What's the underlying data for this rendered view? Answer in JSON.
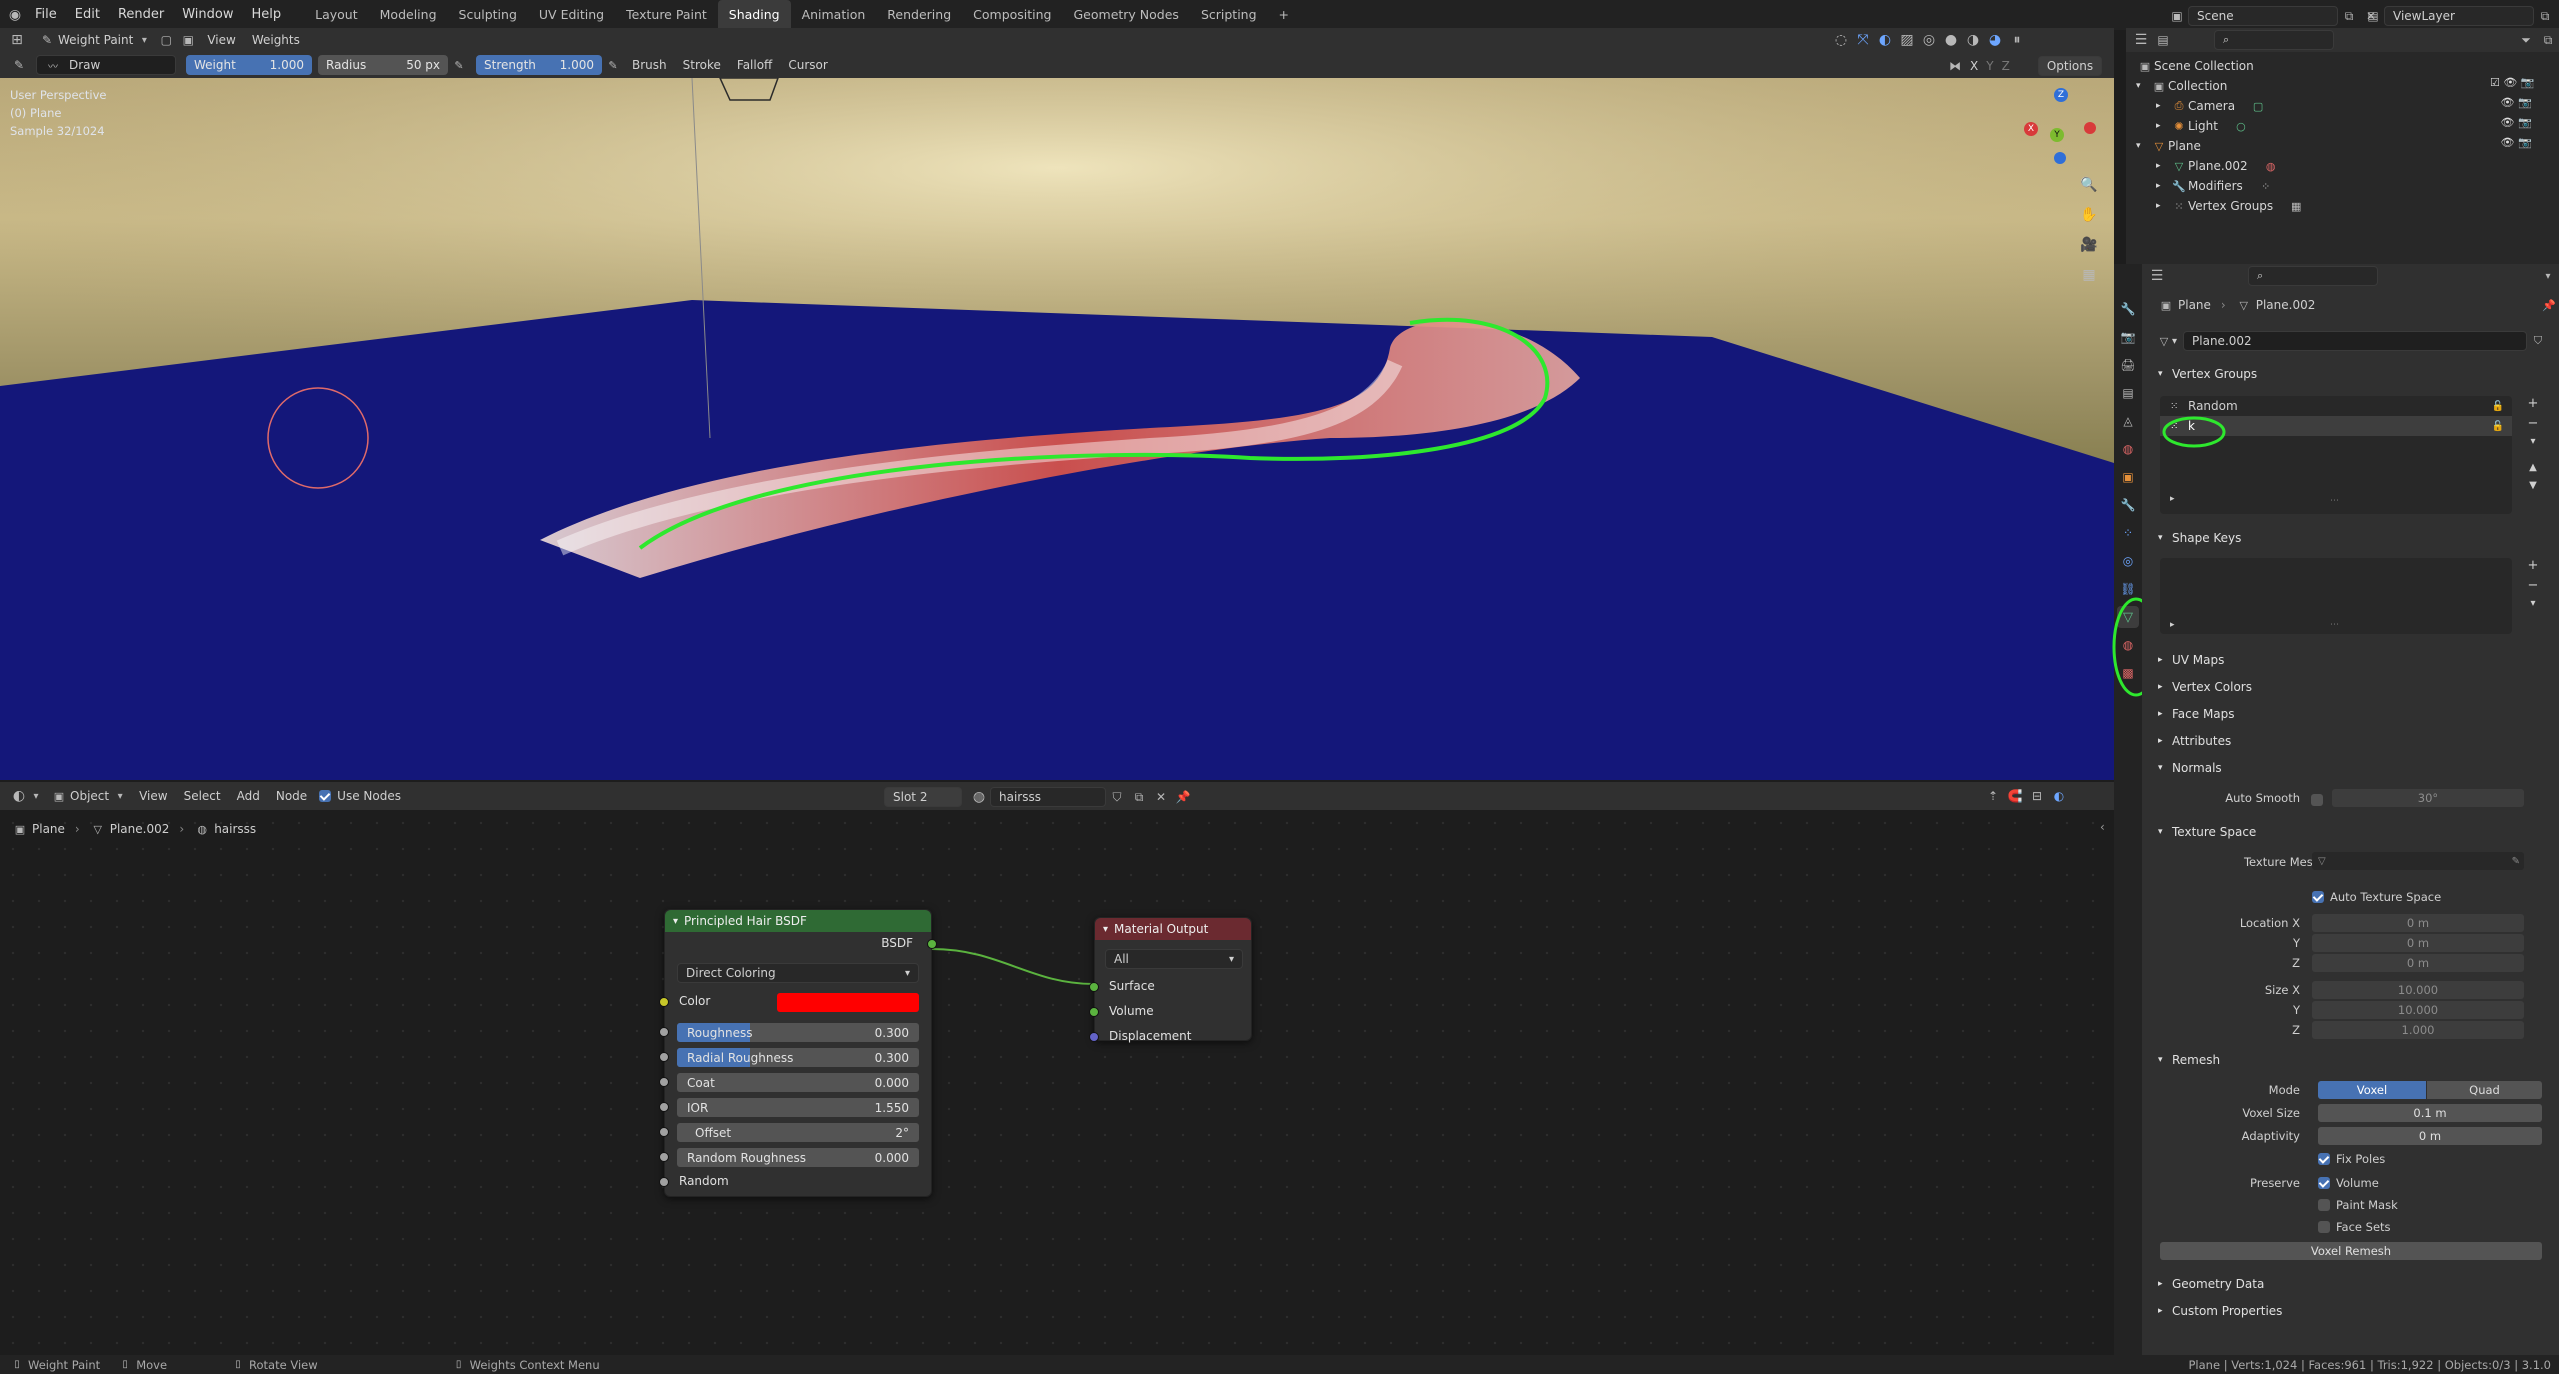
{
  "topbar": {
    "menu": [
      "File",
      "Edit",
      "Render",
      "Window",
      "Help"
    ],
    "workspaces": [
      "Layout",
      "Modeling",
      "Sculpting",
      "UV Editing",
      "Texture Paint",
      "Shading",
      "Animation",
      "Rendering",
      "Compositing",
      "Geometry Nodes",
      "Scripting"
    ],
    "active_workspace": "Shading",
    "add_tab": "+",
    "scene": "Scene",
    "view_layer": "ViewLayer"
  },
  "mode_header": {
    "mode": "Weight Paint",
    "menus": [
      "View",
      "Weights"
    ]
  },
  "tool_header": {
    "tool": "Draw",
    "weight_label": "Weight",
    "weight_value": "1.000",
    "radius_label": "Radius",
    "radius_value": "50 px",
    "strength_label": "Strength",
    "strength_value": "1.000",
    "dropdowns": [
      "Brush",
      "Stroke",
      "Falloff",
      "Cursor"
    ],
    "mirror_axes": [
      "X",
      "Y",
      "Z"
    ],
    "options": "Options"
  },
  "viewport": {
    "overlay_lines": [
      "User Perspective",
      "(0) Plane",
      "Sample 32/1024"
    ]
  },
  "node_editor": {
    "object_mode": "Object",
    "menus": [
      "View",
      "Select",
      "Add",
      "Node"
    ],
    "use_nodes_label": "Use Nodes",
    "slot": "Slot 2",
    "material": "hairsss",
    "breadcrumb": [
      "Plane",
      "Plane.002",
      "hairsss"
    ],
    "hair_node": {
      "title": "Principled Hair BSDF",
      "output": "BSDF",
      "parametrization": "Direct Coloring",
      "color_label": "Color",
      "color_value": "#ff0000",
      "params": [
        {
          "label": "Roughness",
          "value": "0.300",
          "fill": 0.3
        },
        {
          "label": "Radial Roughness",
          "value": "0.300",
          "fill": 0.3
        },
        {
          "label": "Coat",
          "value": "0.000",
          "fill": 0
        },
        {
          "label": "IOR",
          "value": "1.550",
          "fill": 0
        },
        {
          "label": "Offset",
          "value": "2°",
          "fill": 0
        },
        {
          "label": "Random Roughness",
          "value": "0.000",
          "fill": 0
        }
      ],
      "random_label": "Random"
    },
    "output_node": {
      "title": "Material Output",
      "target": "All",
      "inputs": [
        "Surface",
        "Volume",
        "Displacement"
      ]
    }
  },
  "status_bar": {
    "items": [
      "Weight Paint",
      "Move",
      "Rotate View",
      "Weights Context Menu"
    ],
    "stats": "Plane | Verts:1,024 | Faces:961 | Tris:1,922 | Objects:0/3 | 3.1.0"
  },
  "outliner": {
    "items": [
      {
        "label": "Scene Collection"
      },
      {
        "label": "Collection"
      },
      {
        "label": "Camera"
      },
      {
        "label": "Light"
      },
      {
        "label": "Plane"
      },
      {
        "label": "Plane.002"
      },
      {
        "label": "Modifiers"
      },
      {
        "label": "Vertex Groups"
      }
    ]
  },
  "properties": {
    "breadcrumb": [
      "Plane",
      "Plane.002"
    ],
    "mesh_name": "Plane.002",
    "sections": {
      "vertex_groups": "Vertex Groups",
      "shape_keys": "Shape Keys",
      "uv_maps": "UV Maps",
      "vertex_colors": "Vertex Colors",
      "face_maps": "Face Maps",
      "attributes": "Attributes",
      "normals": "Normals",
      "texture_space": "Texture Space",
      "remesh": "Remesh",
      "geometry_data": "Geometry Data",
      "custom_properties": "Custom Properties"
    },
    "vertex_group_items": [
      "Random",
      "k"
    ],
    "auto_smooth_label": "Auto Smooth",
    "auto_smooth_angle": "30°",
    "texture_mesh_label": "Texture Mesh",
    "auto_texture_space": "Auto Texture Space",
    "location_label": "Location X",
    "size_label": "Size X",
    "axis_y": "Y",
    "axis_z": "Z",
    "location_values": [
      "0 m",
      "0 m",
      "0 m"
    ],
    "size_values": [
      "10.000",
      "10.000",
      "1.000"
    ],
    "remesh": {
      "mode_label": "Mode",
      "mode_options": [
        "Voxel",
        "Quad"
      ],
      "voxel_size_label": "Voxel Size",
      "voxel_size": "0.1 m",
      "adaptivity_label": "Adaptivity",
      "adaptivity": "0 m",
      "fix_poles": "Fix Poles",
      "preserve_label": "Preserve",
      "preserve_options": [
        "Volume",
        "Paint Mask",
        "Face Sets"
      ],
      "button": "Voxel Remesh"
    }
  }
}
